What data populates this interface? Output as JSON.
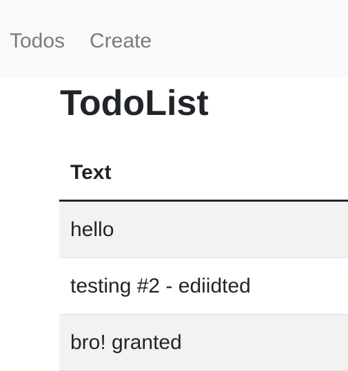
{
  "navbar": {
    "links": [
      {
        "label": "Todos"
      },
      {
        "label": "Create"
      }
    ]
  },
  "main": {
    "title": "TodoList",
    "table": {
      "headers": [
        "Text"
      ],
      "rows": [
        {
          "text": "hello"
        },
        {
          "text": "testing #2 - ediidted"
        },
        {
          "text": "bro! granted"
        }
      ]
    }
  },
  "colors": {
    "navbar_bg": "#f8f9fa",
    "nav_link": "#7a7b7d",
    "text": "#212529",
    "stripe": "#f2f2f2"
  }
}
